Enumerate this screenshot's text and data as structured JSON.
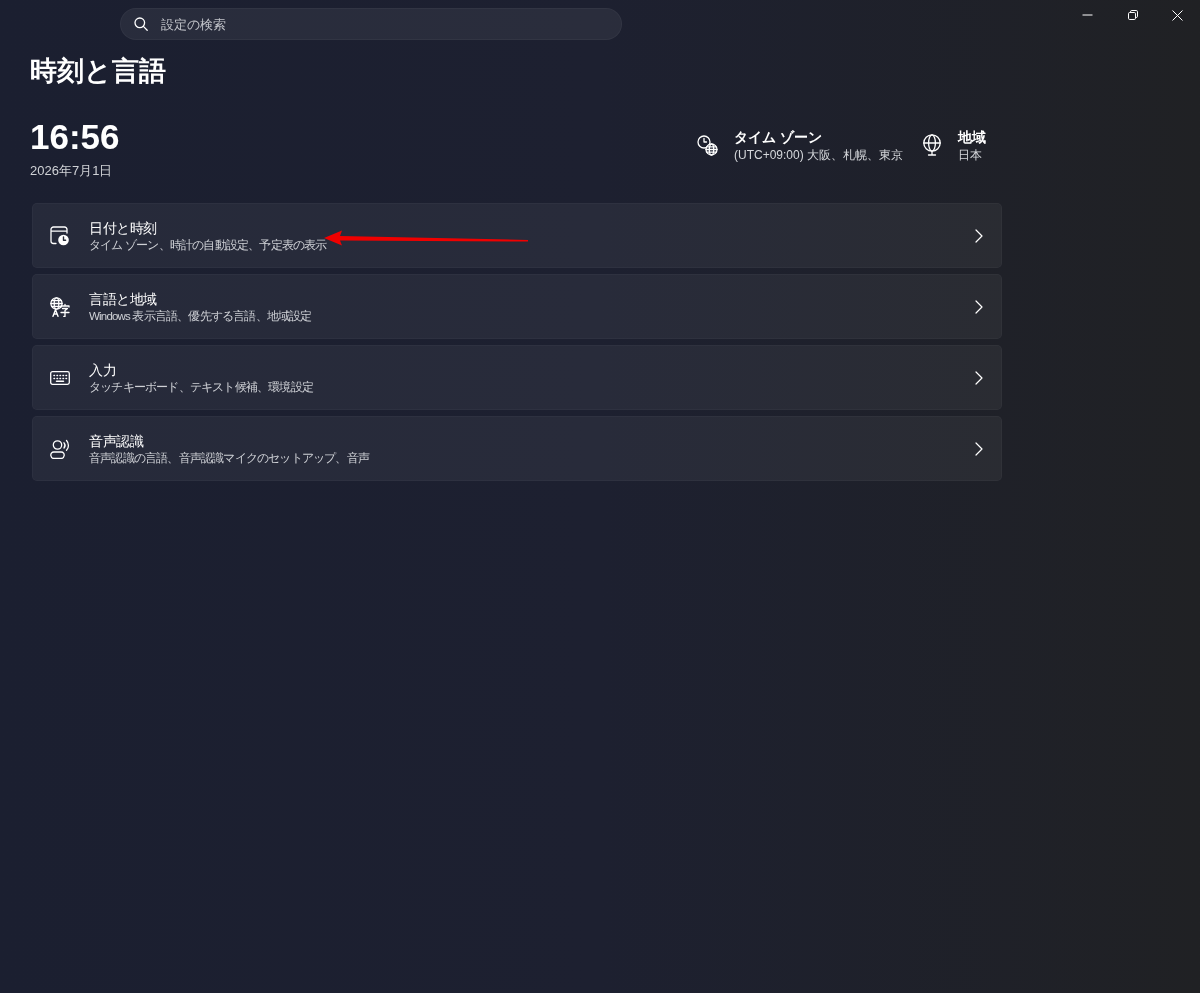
{
  "window": {
    "controls": [
      {
        "kind": "minimize"
      },
      {
        "kind": "restore"
      },
      {
        "kind": "close"
      }
    ]
  },
  "search": {
    "placeholder": "設定の検索"
  },
  "page_title": "時刻と言語",
  "clock": {
    "time": "16:56",
    "date": "2026年7月1日"
  },
  "summary": [
    {
      "kind": "time_zone",
      "label": "タイム ゾーン",
      "value": "(UTC+09:00) 大阪、札幌、東京"
    },
    {
      "kind": "region",
      "label": "地域",
      "value": "日本"
    }
  ],
  "settings": [
    {
      "kind": "date_time",
      "title": "日付と時刻",
      "description": "タイム ゾーン、時計の自動設定、予定表の表示"
    },
    {
      "kind": "language",
      "title": "言語と地域",
      "description": "Windows 表示言語、優先する言語、地域設定"
    },
    {
      "kind": "typing",
      "title": "入力",
      "description": "タッチキーボード、テキスト候補、環境設定"
    },
    {
      "kind": "speech",
      "title": "音声認識",
      "description": "音声認識の言語、音声認識マイクのセットアップ、音声"
    }
  ],
  "annotations": [
    {
      "kind": "arrow"
    }
  ]
}
